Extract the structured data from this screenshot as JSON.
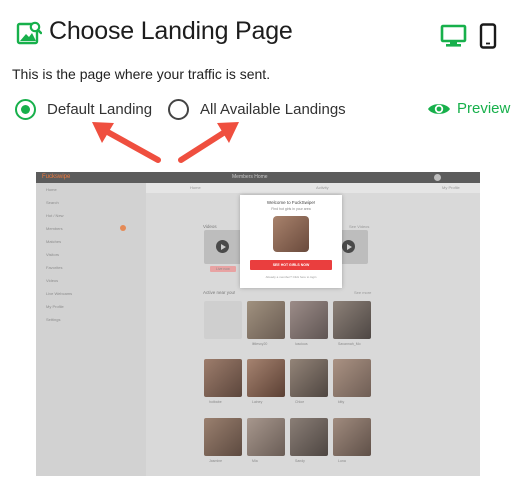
{
  "header": {
    "title": "Choose Landing Page",
    "title_icon": "landing-image-icon",
    "desktop_icon": "desktop-icon",
    "mobile_icon": "mobile-phone-icon"
  },
  "subtitle": "This is the page where your traffic is sent.",
  "options": {
    "default_label": "Default Landing",
    "all_label": "All Available Landings",
    "selected": "Default Landing"
  },
  "preview": {
    "label": "Preview",
    "icon": "eye-icon"
  },
  "colors": {
    "accent": "#17b04b",
    "arrow": "#ef4f3f",
    "cta": "#ea3e3e"
  },
  "screenshot": {
    "brand": "Fuckswipe",
    "topbar_title": "Members Home",
    "tabs": [
      "Home",
      "Activity",
      "My Profile"
    ],
    "sidebar": [
      "Home",
      "Search",
      "Hot / New",
      "Members",
      "Matches",
      "Visitors",
      "Favorites",
      "Videos",
      "Live Webcams",
      "My Profile",
      "Settings"
    ],
    "videos_label": "Videos",
    "videos_link": "See Videos",
    "videos_buttons": [
      "Live now"
    ],
    "active_label": "Active near you!",
    "active_link": "See more",
    "members": [
      "littlesxy20",
      "luscious",
      "Savannah_Mo",
      "hotbabe",
      "Lainey",
      "Chloe",
      "kitty",
      "Jasmine",
      "Mia",
      "Sandy",
      "Luna",
      "Violet"
    ],
    "modal": {
      "title": "Welcome to FuckSwipe!",
      "subtitle": "Find hot girls in your area",
      "button": "SEE HOT GIRLS NOW",
      "footer": "Already a member? Click here to login"
    }
  }
}
